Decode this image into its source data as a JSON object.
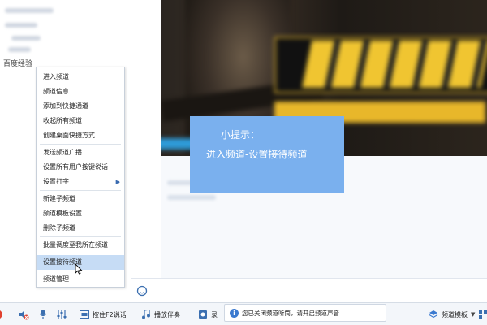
{
  "sidebar": {
    "watermark": "百度经验"
  },
  "context_menu": {
    "items": [
      {
        "label": "进入频道"
      },
      {
        "label": "频道信息"
      },
      {
        "label": "添加到快捷通道"
      },
      {
        "label": "收起所有频道"
      },
      {
        "label": "创建桌面快捷方式"
      },
      {
        "label": "发送频道广播"
      },
      {
        "label": "设置所有用户按键说话"
      },
      {
        "label": "设置打字"
      },
      {
        "label": "新建子频道"
      },
      {
        "label": "频道模板设置"
      },
      {
        "label": "删除子频道"
      },
      {
        "label": "批量调度至我所在频道"
      },
      {
        "label": "设置接待频道"
      },
      {
        "label": "频道管理"
      }
    ]
  },
  "tip": {
    "title": "小提示：",
    "text": "进入频道-设置接待频道"
  },
  "toolbar": {
    "f2_label": "按住F2说话",
    "accompany_label": "播放伴奏",
    "record_label": "录",
    "template_label": "频道模板"
  },
  "notice": {
    "text": "您已关闭频道听筒，请开启频道声音"
  },
  "colors": {
    "tip_bg": "#7ab0ee",
    "menu_selected": "#c6dcf5",
    "accent": "#3b7ad0"
  }
}
